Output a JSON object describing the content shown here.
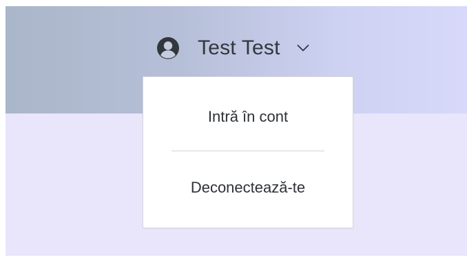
{
  "header": {
    "user_name": "Test Test",
    "avatar_icon": "user-circle-icon",
    "chevron_icon": "chevron-down-icon"
  },
  "dropdown": {
    "items": [
      {
        "label": "Intră în cont"
      },
      {
        "label": "Deconectează-te"
      }
    ]
  },
  "colors": {
    "header_gradient_start": "#aab6c9",
    "header_gradient_end": "#d8d9fa",
    "page_background": "#e9e5fb",
    "text": "#33373d"
  }
}
